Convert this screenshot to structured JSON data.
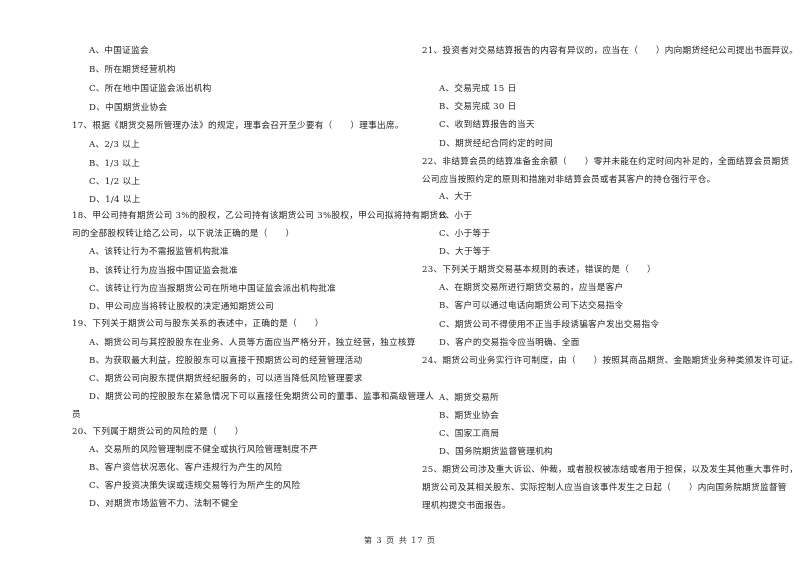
{
  "left_column": {
    "q16_options": [
      "A、中国证监会",
      "B、所在期货经营机构",
      "C、所在地中国证监会派出机构",
      "D、中国期货业协会"
    ],
    "q17": {
      "stem": "17、根据《期货交易所管理办法》的规定，理事会召开至少要有（　　）理事出席。",
      "options": [
        "A、2/3 以上",
        "B、1/3 以上",
        "C、1/2 以上",
        "D、1/4 以上"
      ]
    },
    "q18": {
      "stem_line1": "18、甲公司持有期货公司 3%的股权，乙公司持有该期货公司 3%股权，甲公司拟将持有期货公",
      "stem_line2": "司的全部股权转让给乙公司，以下说法正确的是（　　）",
      "options": [
        "A、该转让行为不需报监管机构批准",
        "B、该转让行为应当报中国证监会批准",
        "C、该转让行为应当报期货公司在所地中国证监会派出机构批准",
        "D、甲公司应当将转让股权的决定通知期货公司"
      ]
    },
    "q19": {
      "stem": "19、下列关于期货公司与股东关系的表述中，正确的是（　　）",
      "options": [
        "A、期货公司与其控股股东在业务、人员等方面应当严格分开，独立经营，独立核算",
        "B、为获取最大利益，控股股东可以直接干预期货公司的经营管理活动",
        "C、期货公司向股东提供期货经纪服务的，可以适当降低风险管理要求",
        "D、期货公司的控股股东在紧急情况下可以直接任免期货公司的董事、监事和高级管理人"
      ],
      "option_d_wrap": "员"
    },
    "q20": {
      "stem": "20、下列属于期货公司的风险的是（　　）",
      "options": [
        "A、交易所的风险管理制度不健全或执行风险管理制度不严",
        "B、客户资信状况恶化、客户违规行为产生的风险",
        "C、客户投资决策失误或违规交易等行为所产生的风险",
        "D、对期货市场监管不力、法制不健全"
      ]
    }
  },
  "right_column": {
    "q21": {
      "stem": "21、投资者对交易结算报告的内容有异议的，应当在（　　）内向期货经纪公司提出书面异议。",
      "options": [
        "A、交易完成 15 日",
        "B、交易完成 30 日",
        "C、收到结算报告的当天",
        "D、期货经纪合同约定的时间"
      ]
    },
    "q22": {
      "stem_line1": "22、非结算会员的结算准备金余额（　　）零并未能在约定时间内补足的，全面结算会员期货",
      "stem_line2": "公司应当按照约定的原则和措施对非结算会员或者其客户的持仓强行平仓。",
      "options": [
        "A、大于",
        "B、小于",
        "C、小于等于",
        "D、大于等于"
      ]
    },
    "q23": {
      "stem": "23、下列关于期货交易基本规则的表述，错误的是（　　）",
      "options": [
        "A、在期货交易所进行期货交易的，应当是客户",
        "B、客户可以通过电话向期货公司下达交易指令",
        "C、期货公司不得使用不正当手段诱骗客户发出交易指令",
        "D、客户的交易指令应当明确、全面"
      ]
    },
    "q24": {
      "stem": "24、期货公司业务实行许可制度，由（　　）按照其商品期货、金融期货业务种类颁发许可证。",
      "options": [
        "A、期货交易所",
        "B、期货业协会",
        "C、国家工商局",
        "D、国务院期货监督管理机构"
      ]
    },
    "q25": {
      "stem_line1": "25、期货公司涉及重大诉讼、仲裁，或者股权被冻结或者用于担保，以及发生其他重大事件时，",
      "stem_line2": "期货公司及其相关股东、实际控制人应当自该事件发生之日起（　　）内向国务院期货监督管",
      "stem_line3": "理机构提交书面报告。"
    }
  },
  "footer": {
    "page_label": "第 3 页 共 17 页"
  }
}
